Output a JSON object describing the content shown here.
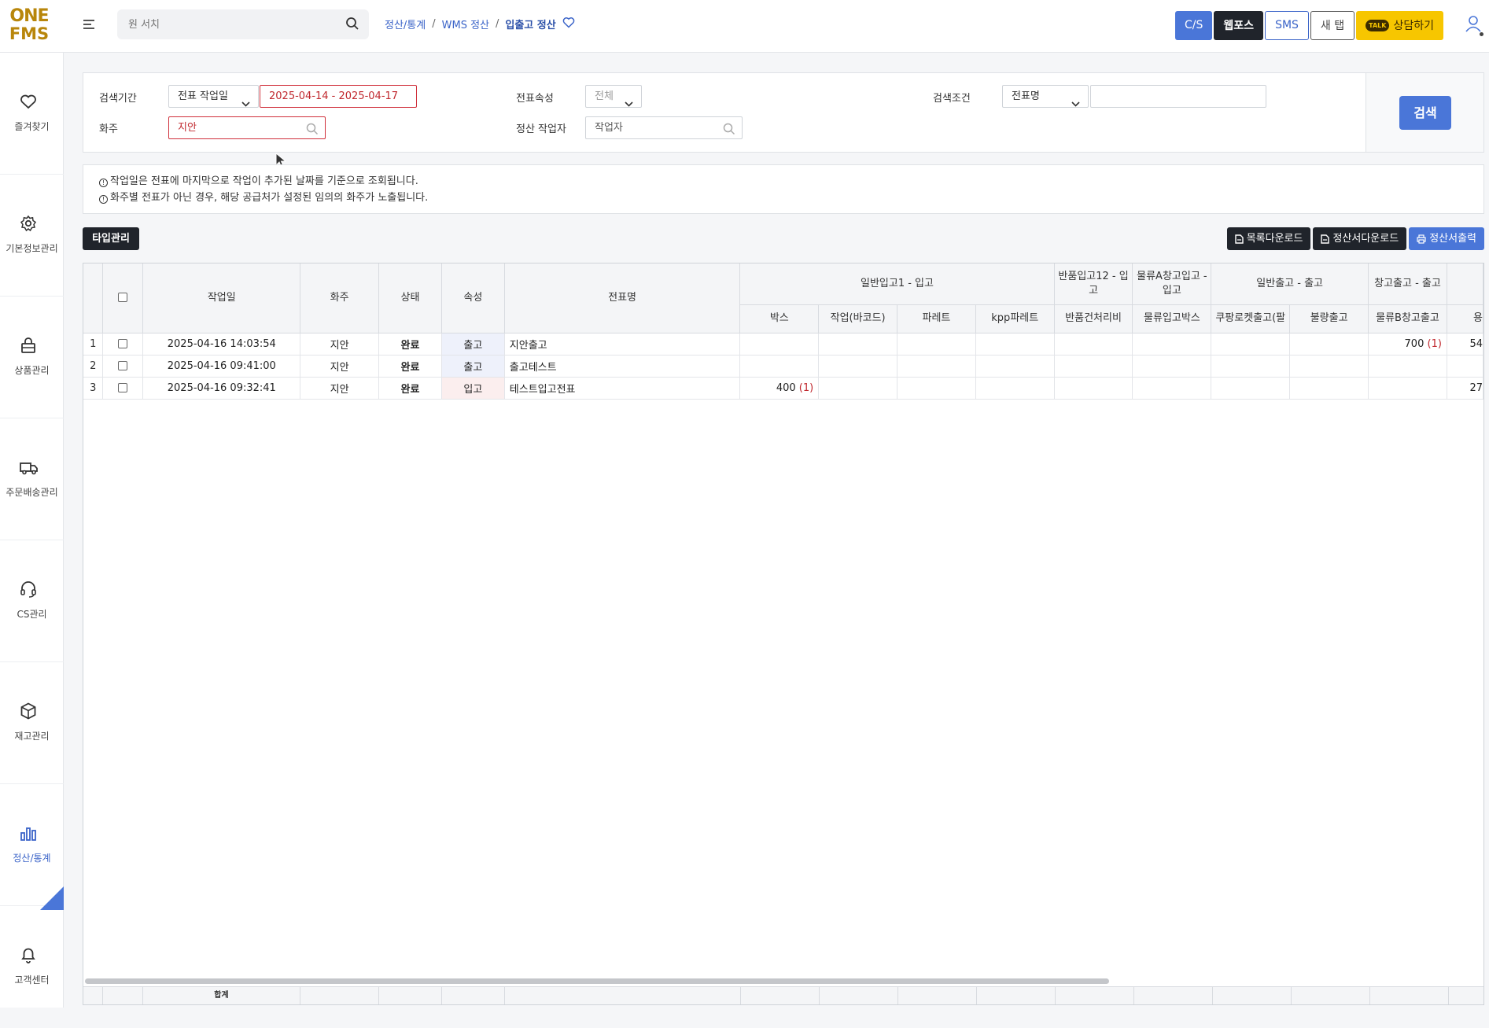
{
  "logo": {
    "line1": "ONE",
    "line2": "FMS"
  },
  "header": {
    "search_placeholder": "원 서치",
    "breadcrumb": [
      "정산/통계",
      "WMS 정산",
      "입출고 정산"
    ],
    "buttons": {
      "cs": "C/S",
      "webpos": "웹포스",
      "sms": "SMS",
      "newtab": "새 탭",
      "talk": "상담하기",
      "talk_badge": "TALK"
    }
  },
  "sidebar": {
    "items": [
      {
        "label": "즐겨찾기",
        "icon": "heart-icon"
      },
      {
        "label": "기본정보관리",
        "icon": "gear-icon"
      },
      {
        "label": "상품관리",
        "icon": "bag-icon"
      },
      {
        "label": "주문배송관리",
        "icon": "truck-icon"
      },
      {
        "label": "CS관리",
        "icon": "headset-icon"
      },
      {
        "label": "재고관리",
        "icon": "box-icon"
      },
      {
        "label": "정산/통계",
        "icon": "chart-icon"
      },
      {
        "label": "고객센터",
        "icon": "bell-icon"
      }
    ]
  },
  "filter": {
    "period_label": "검색기간",
    "period_type": "전표 작업일",
    "period_range": "2025-04-14 - 2025-04-17",
    "shipper_label": "화주",
    "shipper_value": "지안",
    "attr_label": "전표속성",
    "attr_value": "전체",
    "worker_label": "정산 작업자",
    "worker_placeholder": "작업자",
    "cond_label": "검색조건",
    "cond_value": "전표명",
    "cond_input": "",
    "search_button": "검색"
  },
  "notice": {
    "line1": "작업일은 전표에 마지막으로 작업이 추가된 날짜를 기준으로 조회됩니다.",
    "line2": "화주별 전표가 아닌 경우, 해당 공급처가 설정된 임의의 화주가 노출됩니다."
  },
  "toolbar": {
    "type_button": "타입관리",
    "list_download": "목록다운로드",
    "statement_download": "정산서다운로드",
    "statement_print": "정산서출력"
  },
  "grid": {
    "headers": {
      "workdate": "작업일",
      "shipper": "화주",
      "status": "상태",
      "attr": "속성",
      "name": "전표명",
      "g1": "일반입고1 - 입고",
      "g2": "반품입고12 - 입고",
      "g3": "물류A창고입고 - 입고",
      "g4": "일반출고 - 출고",
      "g5": "창고출고 - 출고"
    },
    "subheaders": [
      "박스",
      "작업(바코드)",
      "파레트",
      "kpp파레트",
      "반품건처리비",
      "물류입고박스",
      "쿠팡로켓출고(팔",
      "불량출고",
      "물류B창고출고",
      "용"
    ],
    "rows": [
      {
        "no": "1",
        "date": "2025-04-16 14:03:54",
        "shipper": "지안",
        "status": "완료",
        "attr": "출고",
        "name": "지안출고",
        "box": "",
        "boxcnt": "",
        "bstock": "700",
        "bcnt": "(1)",
        "last": "54"
      },
      {
        "no": "2",
        "date": "2025-04-16 09:41:00",
        "shipper": "지안",
        "status": "완료",
        "attr": "출고",
        "name": "출고테스트",
        "box": "",
        "boxcnt": "",
        "bstock": "",
        "bcnt": "",
        "last": ""
      },
      {
        "no": "3",
        "date": "2025-04-16 09:32:41",
        "shipper": "지안",
        "status": "완료",
        "attr": "입고",
        "name": "테스트입고전표",
        "box": "400",
        "boxcnt": "(1)",
        "bstock": "",
        "bcnt": "",
        "last": "27"
      }
    ],
    "footer_total": "합계"
  }
}
